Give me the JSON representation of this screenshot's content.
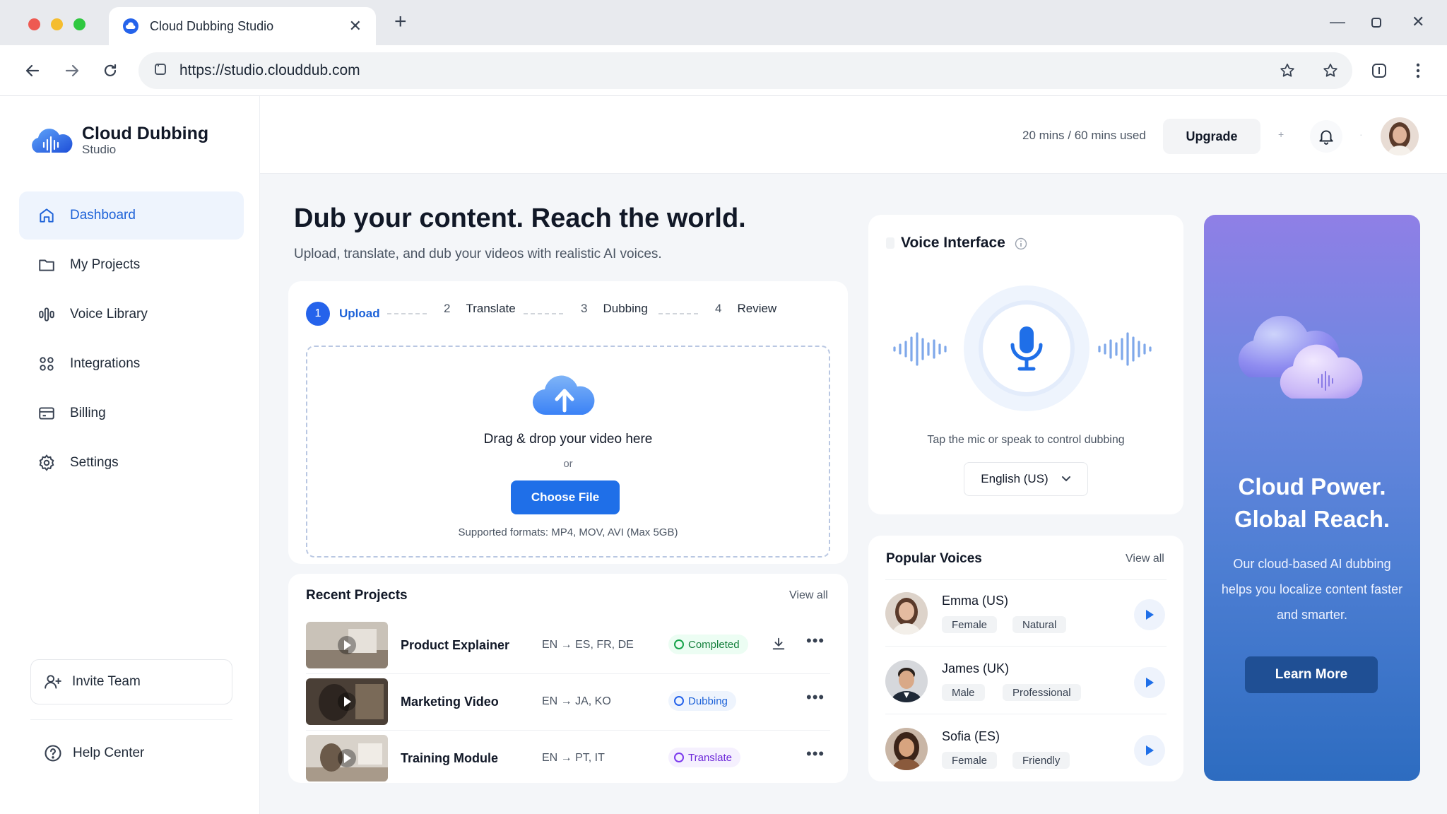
{
  "browser": {
    "tab_title": "Cloud Dubbing Studio",
    "url": "https://studio.clouddub.com"
  },
  "sidebar": {
    "brand_name": "Cloud Dubbing",
    "brand_sub": "Studio",
    "items": [
      {
        "label": "Dashboard",
        "icon": "home-icon",
        "active": true
      },
      {
        "label": "My Projects",
        "icon": "folder-icon"
      },
      {
        "label": "Voice Library",
        "icon": "waveform-icon"
      },
      {
        "label": "Integrations",
        "icon": "integrations-icon"
      },
      {
        "label": "Billing",
        "icon": "billing-icon"
      },
      {
        "label": "Settings",
        "icon": "gear-icon"
      }
    ],
    "invite_label": "Invite Team",
    "help_label": "Help Center"
  },
  "header": {
    "usage": "20 mins / 60 mins used",
    "upgrade_label": "Upgrade"
  },
  "hero": {
    "title": "Dub your content. Reach the world.",
    "subtitle": "Upload, translate, and dub your videos with realistic AI voices."
  },
  "steps": [
    {
      "num": "1",
      "label": "Upload",
      "active": true
    },
    {
      "num": "2",
      "label": "Translate"
    },
    {
      "num": "3",
      "label": "Dubbing"
    },
    {
      "num": "4",
      "label": "Review"
    }
  ],
  "upload": {
    "drop_text": "Drag & drop your video here",
    "or_text": "or",
    "button_label": "Choose File",
    "formats": "Supported formats: MP4, MOV, AVI (Max 5GB)"
  },
  "recent": {
    "title": "Recent Projects",
    "view_all": "View all",
    "rows": [
      {
        "name": "Product Explainer",
        "langs": "EN → ES, FR, DE",
        "status": "Completed",
        "status_color": "#16a34a"
      },
      {
        "name": "Marketing Video",
        "langs": "EN → JA, KO",
        "status": "Dubbing",
        "status_color": "#2563eb"
      },
      {
        "name": "Training Module",
        "langs": "EN → PT, IT",
        "status": "Translate",
        "status_color": "#7c3aed"
      }
    ]
  },
  "voice_interface": {
    "title": "Voice Interface",
    "hint": "Tap the mic or speak to control dubbing",
    "language": "English (US)"
  },
  "popular_voices": {
    "title": "Popular Voices",
    "view_all": "View all",
    "voices": [
      {
        "name": "Emma (US)",
        "tags": [
          "Female",
          "Natural"
        ]
      },
      {
        "name": "James (UK)",
        "tags": [
          "Male",
          "Professional"
        ]
      },
      {
        "name": "Sofia (ES)",
        "tags": [
          "Female",
          "Friendly"
        ]
      }
    ]
  },
  "promo": {
    "title_line1": "Cloud Power.",
    "title_line2": "Global Reach.",
    "description": "Our cloud-based AI dubbing helps you localize content faster and smarter.",
    "button_label": "Learn More"
  },
  "colors": {
    "accent": "#1f6fe8",
    "completed": "#16a34a",
    "dubbing": "#2563eb",
    "translate": "#7c3aed"
  }
}
